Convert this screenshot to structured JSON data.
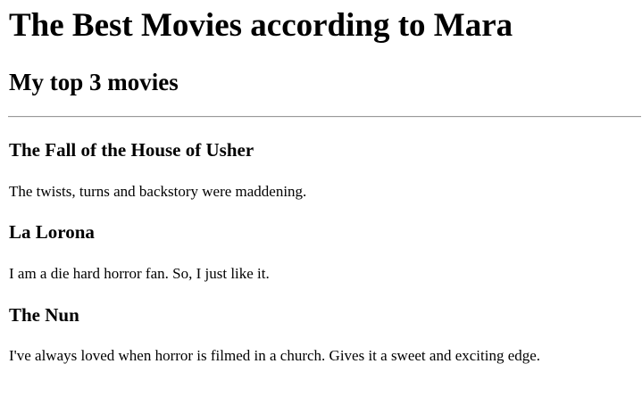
{
  "page": {
    "title": "The Best Movies according to Mara",
    "subtitle": "My top 3 movies"
  },
  "movies": [
    {
      "title": "The Fall of the House of Usher",
      "description": "The twists, turns and backstory were maddening."
    },
    {
      "title": "La Lorona",
      "description": "I am a die hard horror fan. So, I just like it."
    },
    {
      "title": "The Nun",
      "description": "I've always loved when horror is filmed in a church. Gives it a sweet and exciting edge."
    }
  ]
}
